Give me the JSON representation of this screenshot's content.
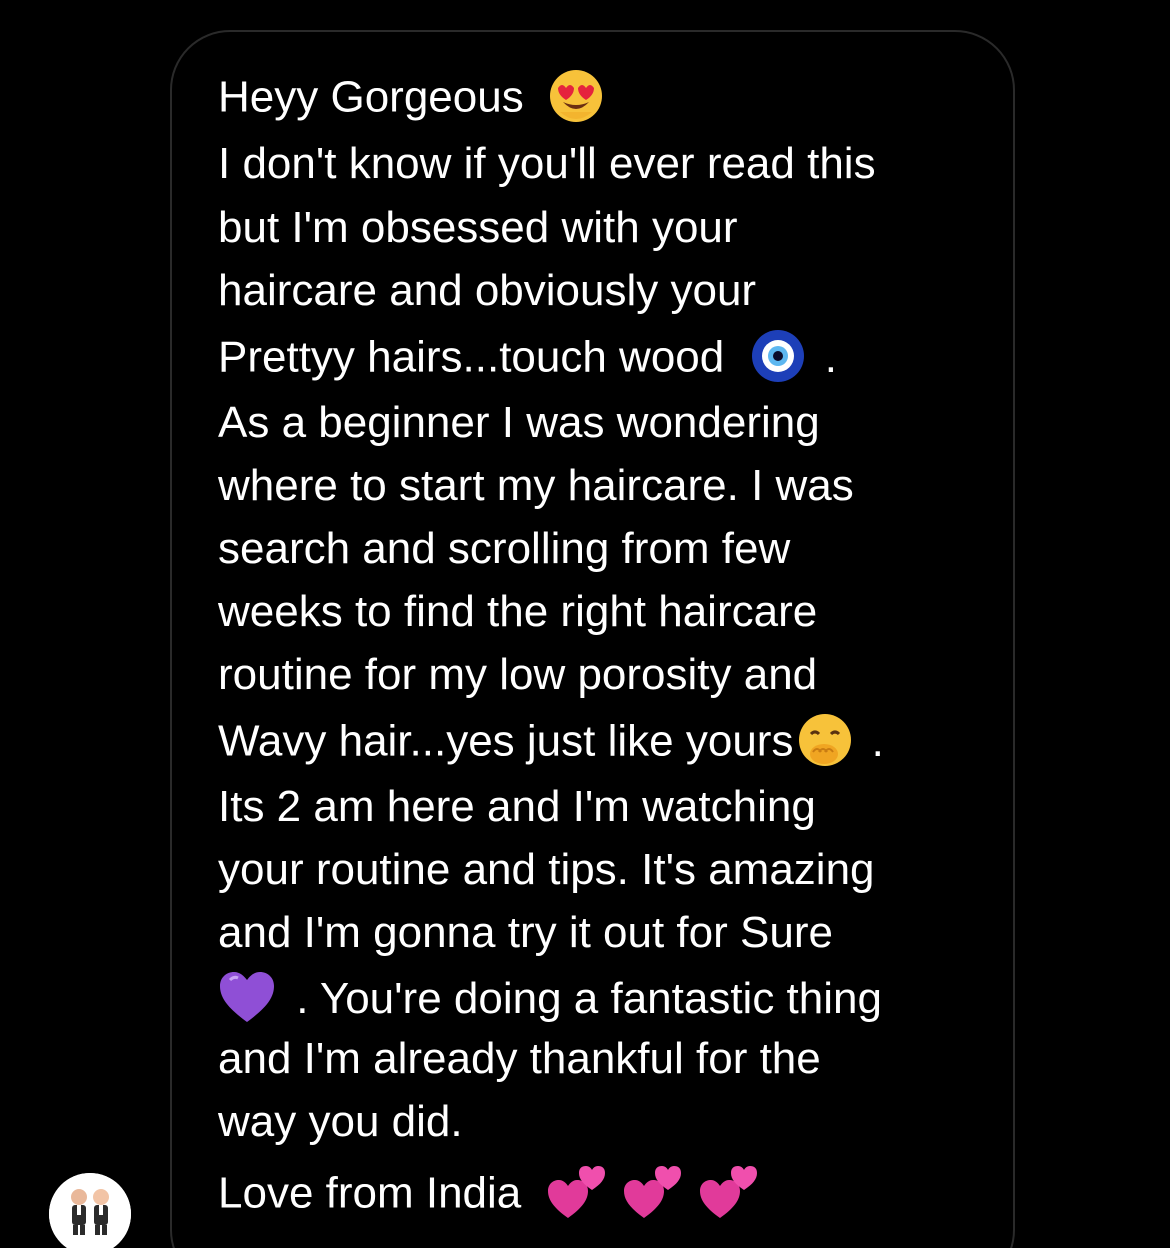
{
  "message": {
    "lines": [
      "Heyy Gorgeous",
      "I don't know if you'll ever read this",
      "but I'm obsessed with your",
      "haircare and obviously your",
      "Prettyy hairs...touch wood",
      ".",
      "As a beginner I was wondering",
      "where to start my haircare. I was",
      "search and scrolling from few",
      "weeks to find the right haircare",
      "routine for my low porosity and",
      "Wavy hair...yes just like yours",
      ".",
      "Its 2 am here and I'm watching",
      "your routine and tips. It's amazing",
      "and I'm gonna try it out for Sure",
      ". You're doing a fantastic thing",
      "and I'm already thankful for the",
      "way you did.",
      "Love from India"
    ],
    "emojis": {
      "line1": "heart-eyes-emoji",
      "line5": "nazar-amulet-emoji",
      "line12": "hand-over-mouth-emoji",
      "line17": "purple-heart-emoji",
      "line20": [
        "two-hearts-emoji",
        "two-hearts-emoji",
        "two-hearts-emoji"
      ]
    }
  },
  "colors": {
    "background": "#000000",
    "bubble_border": "#2a2a2a",
    "text": "#ffffff",
    "purple_heart": "#8f4fd6",
    "pink_hearts": "#e13a9a"
  },
  "sender": {
    "avatar": "boss-baby-avatar-icon"
  }
}
